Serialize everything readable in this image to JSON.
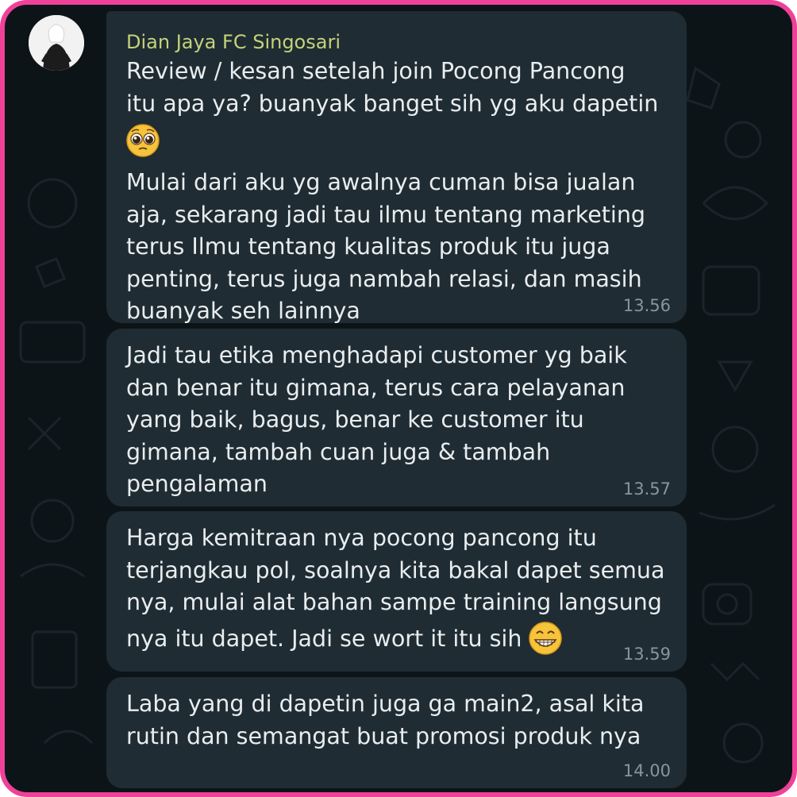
{
  "chat": {
    "sender_name": "Dian Jaya FC Singosari",
    "messages": [
      {
        "text_1": "Review / kesan setelah join Pocong Pancong\nitu apa ya? buanyak banget sih yg aku dapetin",
        "emoji_1": "pleading-face-icon",
        "text_2": "Mulai dari aku yg awalnya cuman bisa jualan\naja, sekarang jadi tau ilmu tentang marketing\nterus Ilmu tentang kualitas produk itu juga\npenting, terus juga nambah relasi, dan masih\nbuanyak seh lainnya",
        "time": "13.56"
      },
      {
        "text": "Jadi tau etika menghadapi customer yg baik\ndan benar itu gimana, terus cara pelayanan\nyang baik, bagus, benar ke customer itu\ngimana, tambah cuan juga & tambah\npengalaman",
        "time": "13.57"
      },
      {
        "text": "Harga kemitraan nya pocong pancong itu\nterjangkau pol, soalnya kita bakal dapet semua\nnya, mulai alat bahan sampe training langsung",
        "text_last": "nya itu dapet. Jadi se wort it itu sih",
        "emoji": "grinning-face-icon",
        "time": "13.59"
      },
      {
        "text": "Laba yang di dapetin juga ga main2, asal kita\nrutin dan semangat buat promosi produk nya",
        "time": "14.00"
      }
    ]
  },
  "colors": {
    "frame_border": "#f0419a",
    "background": "#0d1418",
    "bubble": "#1f2c33",
    "sender_name": "#c5d27a",
    "message_text": "#e9edef",
    "timestamp": "#8696a0"
  }
}
